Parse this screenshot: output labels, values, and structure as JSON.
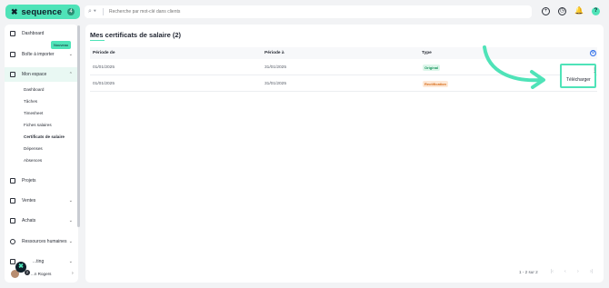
{
  "brand": {
    "name": "sequence",
    "badge": "4"
  },
  "search": {
    "placeholder": "Recherche par mot-clé dans clients"
  },
  "header": {
    "help_label": "?"
  },
  "sidebar": {
    "items": [
      {
        "label": "Dashboard"
      },
      {
        "label": "Boîte à importer",
        "badge": "Nouveau"
      },
      {
        "label": "Mon espace"
      },
      {
        "label": "Projets"
      },
      {
        "label": "Ventes"
      },
      {
        "label": "Achats"
      },
      {
        "label": "Ressources humaines"
      },
      {
        "label": "...ting"
      }
    ],
    "sub_items": [
      "Dashboard",
      "Tâches",
      "Timesheet",
      "Fiches salaires",
      "Certificats de salaire",
      "Dépenses",
      "Absences"
    ],
    "user": {
      "name": "...n Rogers",
      "badge": "2"
    }
  },
  "main": {
    "title": "Mes certificats de salaire (2)",
    "columns": [
      "Période de",
      "Période à",
      "Type"
    ],
    "rows": [
      {
        "from": "01/01/2025",
        "to": "31/01/2025",
        "type": "Original"
      },
      {
        "from": "01/01/2025",
        "to": "31/01/2025",
        "type": "Rectification"
      }
    ],
    "pagination": {
      "label": "1 - 2 sur 2"
    }
  },
  "menu": {
    "download_label": "Télécharger"
  },
  "colors": {
    "accent": "#4fe3b8",
    "original": "#15935b",
    "rectification": "#d86d1a"
  }
}
